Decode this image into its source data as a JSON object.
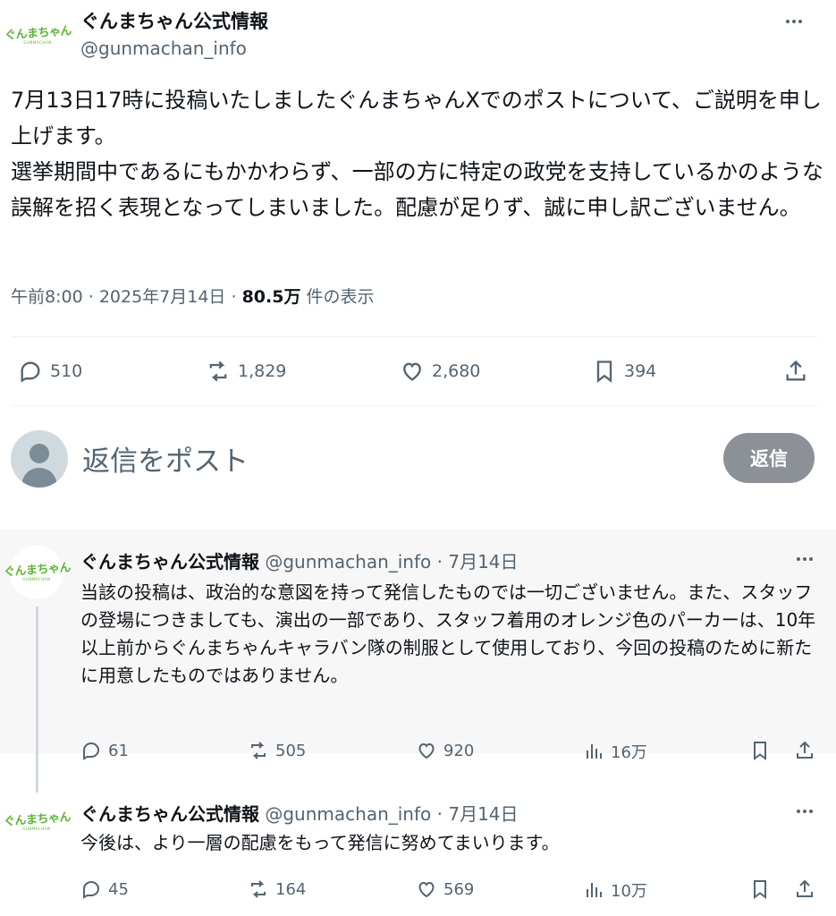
{
  "main_tweet": {
    "author_name": "ぐんまちゃん公式情報",
    "author_handle": "@gunmachan_info",
    "logo_text": "ぐんまちゃん",
    "logo_sub": "GUNMACHAN",
    "body_paragraphs": [
      "7月13日17時に投稿いたしましたぐんまちゃんXでのポストについて、ご説明を申し上げます。",
      "選挙期間中であるにもかかわらず、一部の方に特定の政党を支持しているかのような誤解を招く表現となってしまいました。配慮が足りず、誠に申し訳ございません。"
    ],
    "time": "午前8:00",
    "separator": "·",
    "date": "2025年7月14日",
    "views_count": "80.5万",
    "views_label": "件の表示",
    "replies": "510",
    "reposts": "1,829",
    "likes": "2,680",
    "bookmarks": "394"
  },
  "composer": {
    "placeholder": "返信をポスト",
    "button_label": "返信"
  },
  "replies": [
    {
      "author_name": "ぐんまちゃん公式情報",
      "author_handle": "@gunmachan_info",
      "date": "7月14日",
      "body": "当該の投稿は、政治的な意図を持って発信したものでは一切ございません。また、スタッフの登場につきましても、演出の一部であり、スタッフ着用のオレンジ色のパーカーは、10年以上前からぐんまちゃんキャラバン隊の制服として使用しており、今回の投稿のために新たに用意したものではありません。",
      "replies": "61",
      "reposts": "505",
      "likes": "920",
      "views": "16万"
    },
    {
      "author_name": "ぐんまちゃん公式情報",
      "author_handle": "@gunmachan_info",
      "date": "7月14日",
      "body": "今後は、より一層の配慮をもって発信に努めてまいります。",
      "replies": "45",
      "reposts": "164",
      "likes": "569",
      "views": "10万"
    }
  ],
  "colors": {
    "brand_green": "#5bb531",
    "secondary_text": "#536471",
    "reply_button_bg": "#8b9196"
  }
}
